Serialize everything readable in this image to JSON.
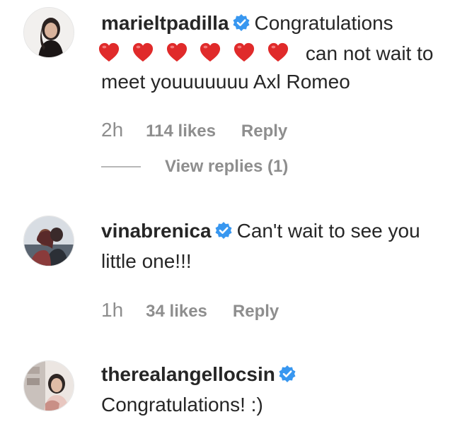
{
  "comments": [
    {
      "username": "marieltpadilla",
      "text_first": "Congratulations",
      "hearts": [
        "heart-icon",
        "heart-icon",
        "heart-icon",
        "heart-icon",
        "heart-icon",
        "heart-icon"
      ],
      "text_after_hearts": "can not wait to meet youuuuuuu Axl Romeo",
      "time": "2h",
      "likes": "114 likes",
      "reply": "Reply",
      "view_replies": "View replies (1)"
    },
    {
      "username": "vinabrenica",
      "text": "Can't wait to see you little one!!!",
      "time": "1h",
      "likes": "34 likes",
      "reply": "Reply"
    },
    {
      "username": "therealangellocsin",
      "text": "Congratulations! :)"
    }
  ],
  "colors": {
    "verified": "#3897f0",
    "heart": "#e02a2a",
    "muted_text": "#8e8e8e",
    "primary_text": "#262626"
  }
}
